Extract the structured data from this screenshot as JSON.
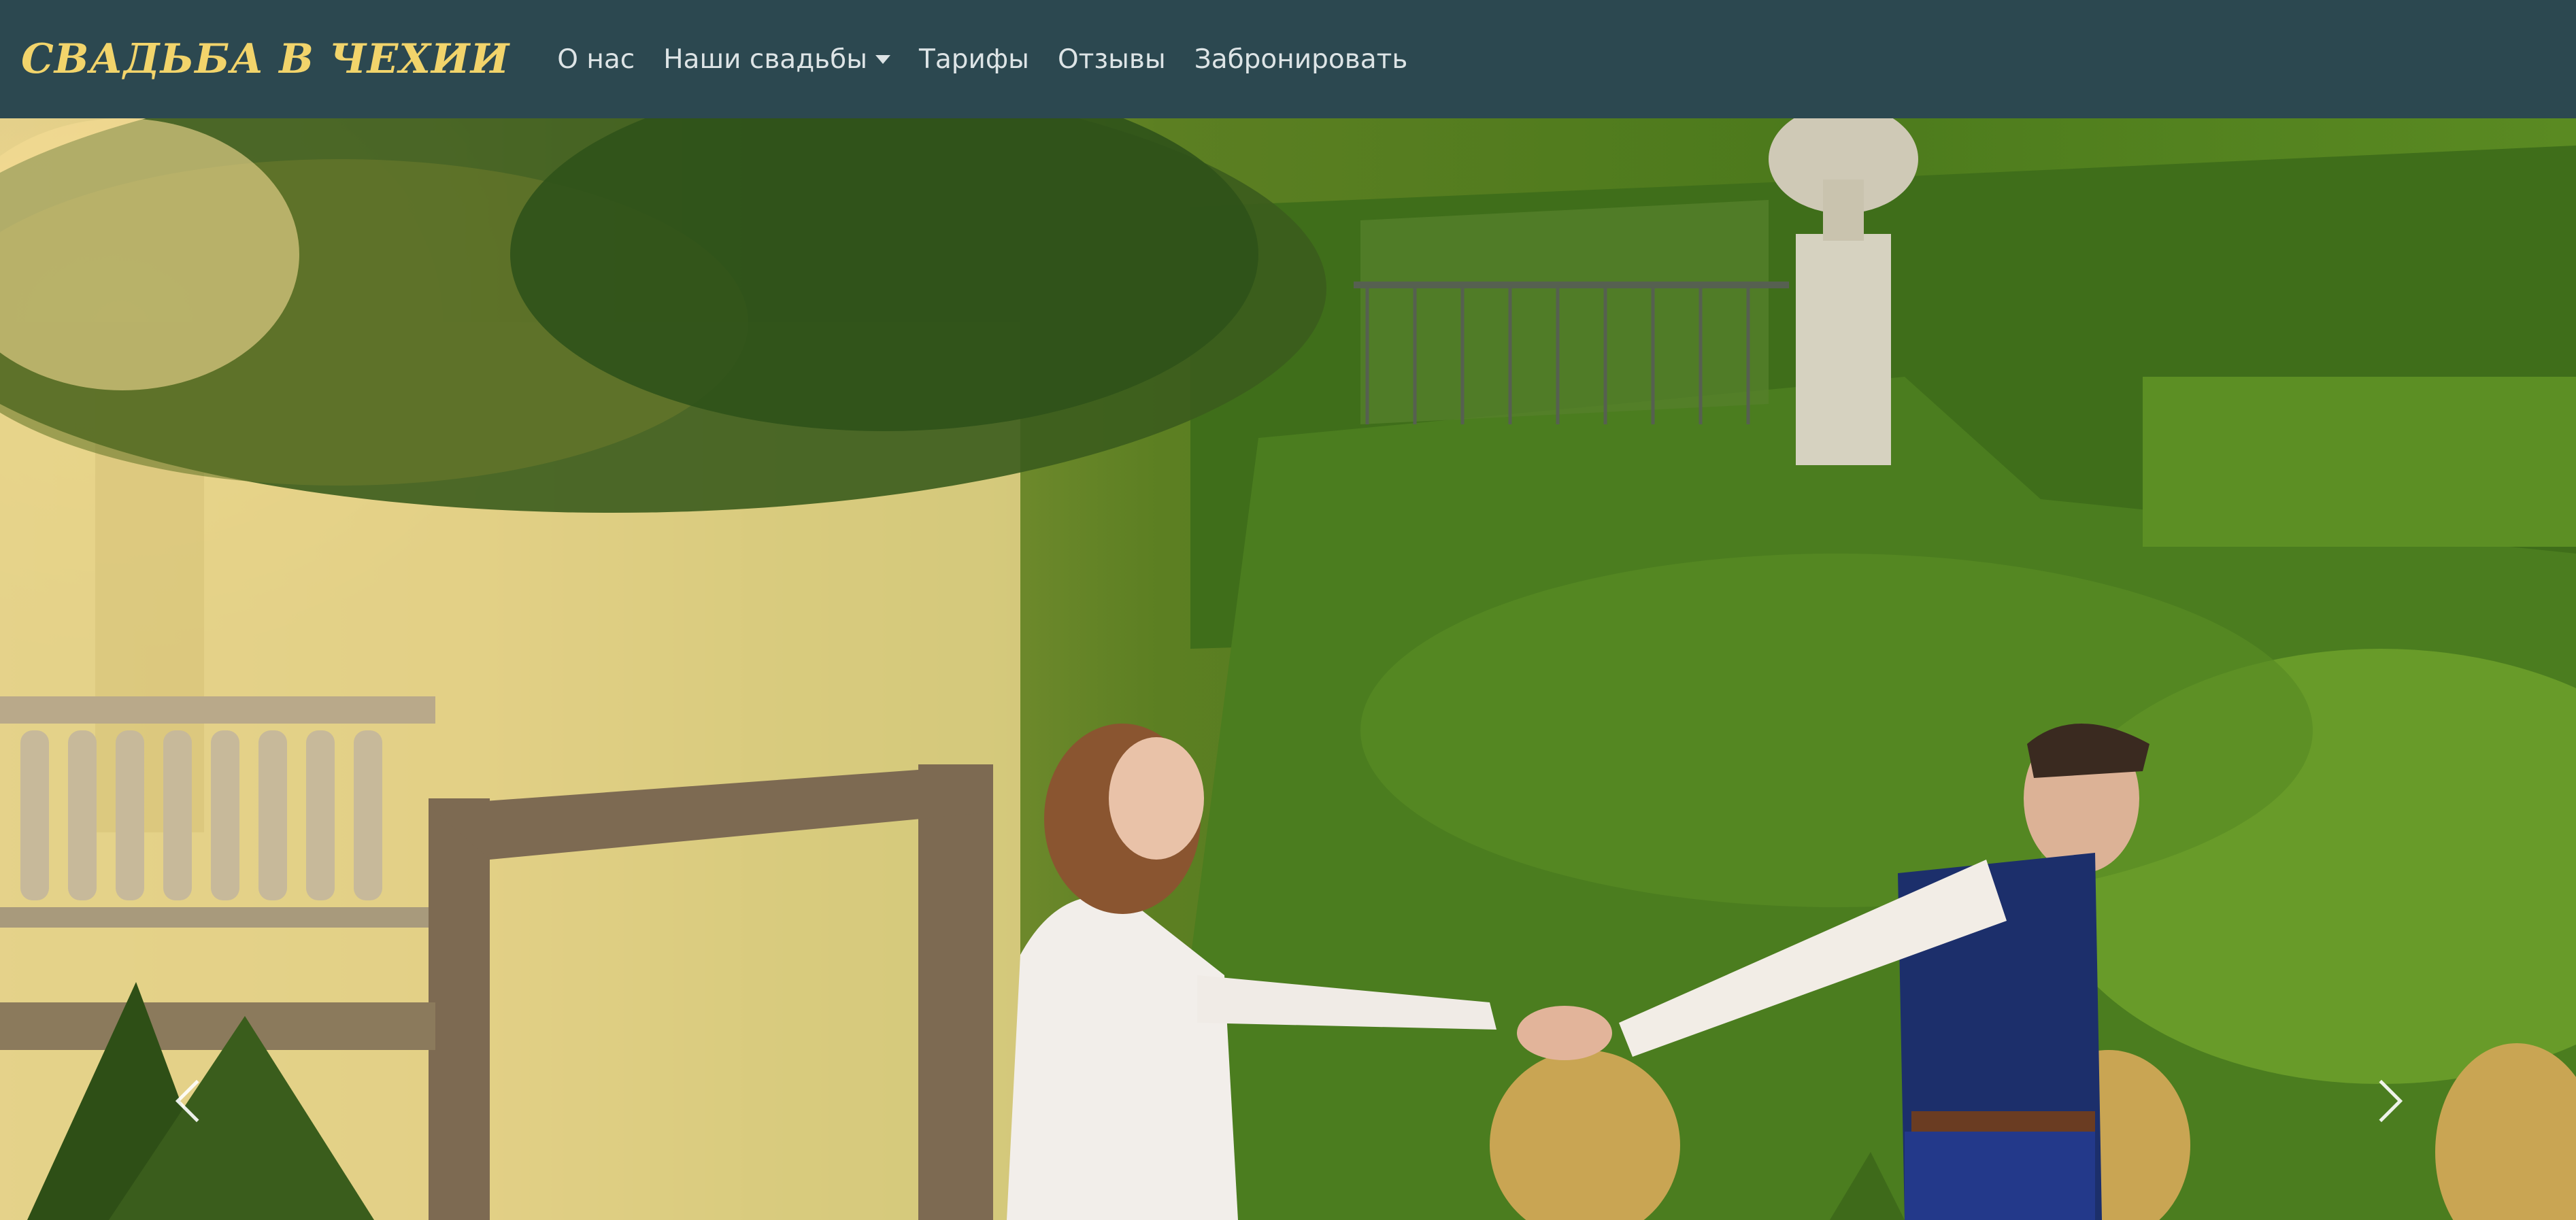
{
  "navbar": {
    "brand": "СВАДЬБА В ЧЕХИИ",
    "links": [
      {
        "label": "О нас"
      },
      {
        "label": "Наши свадьбы",
        "dropdown": true
      },
      {
        "label": "Тарифы"
      },
      {
        "label": "Отзывы"
      },
      {
        "label": "Забронировать"
      }
    ]
  },
  "colors": {
    "navbar_bg": "#2c4850",
    "brand": "#f2d46b",
    "nav_text": "#dde4e6"
  },
  "carousel": {
    "prev_icon": "chevron-left-icon",
    "next_icon": "chevron-right-icon"
  }
}
